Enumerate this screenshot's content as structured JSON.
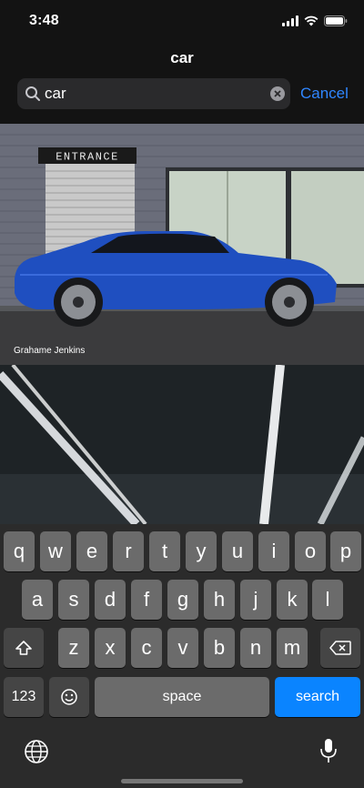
{
  "status_bar": {
    "time": "3:48"
  },
  "nav": {
    "title": "car"
  },
  "search": {
    "value": "car",
    "cancel_label": "Cancel"
  },
  "photos": [
    {
      "credit": "Grahame Jenkins",
      "sign_text": "ENTRANCE"
    },
    {
      "credit": ""
    }
  ],
  "keyboard": {
    "row1": [
      "q",
      "w",
      "e",
      "r",
      "t",
      "y",
      "u",
      "i",
      "o",
      "p"
    ],
    "row2": [
      "a",
      "s",
      "d",
      "f",
      "g",
      "h",
      "j",
      "k",
      "l"
    ],
    "row3": [
      "z",
      "x",
      "c",
      "v",
      "b",
      "n",
      "m"
    ],
    "numbers_label": "123",
    "space_label": "space",
    "search_label": "search"
  },
  "colors": {
    "accent": "#2f86ff",
    "search_key": "#0a84ff",
    "car": "#1f4fc0"
  }
}
